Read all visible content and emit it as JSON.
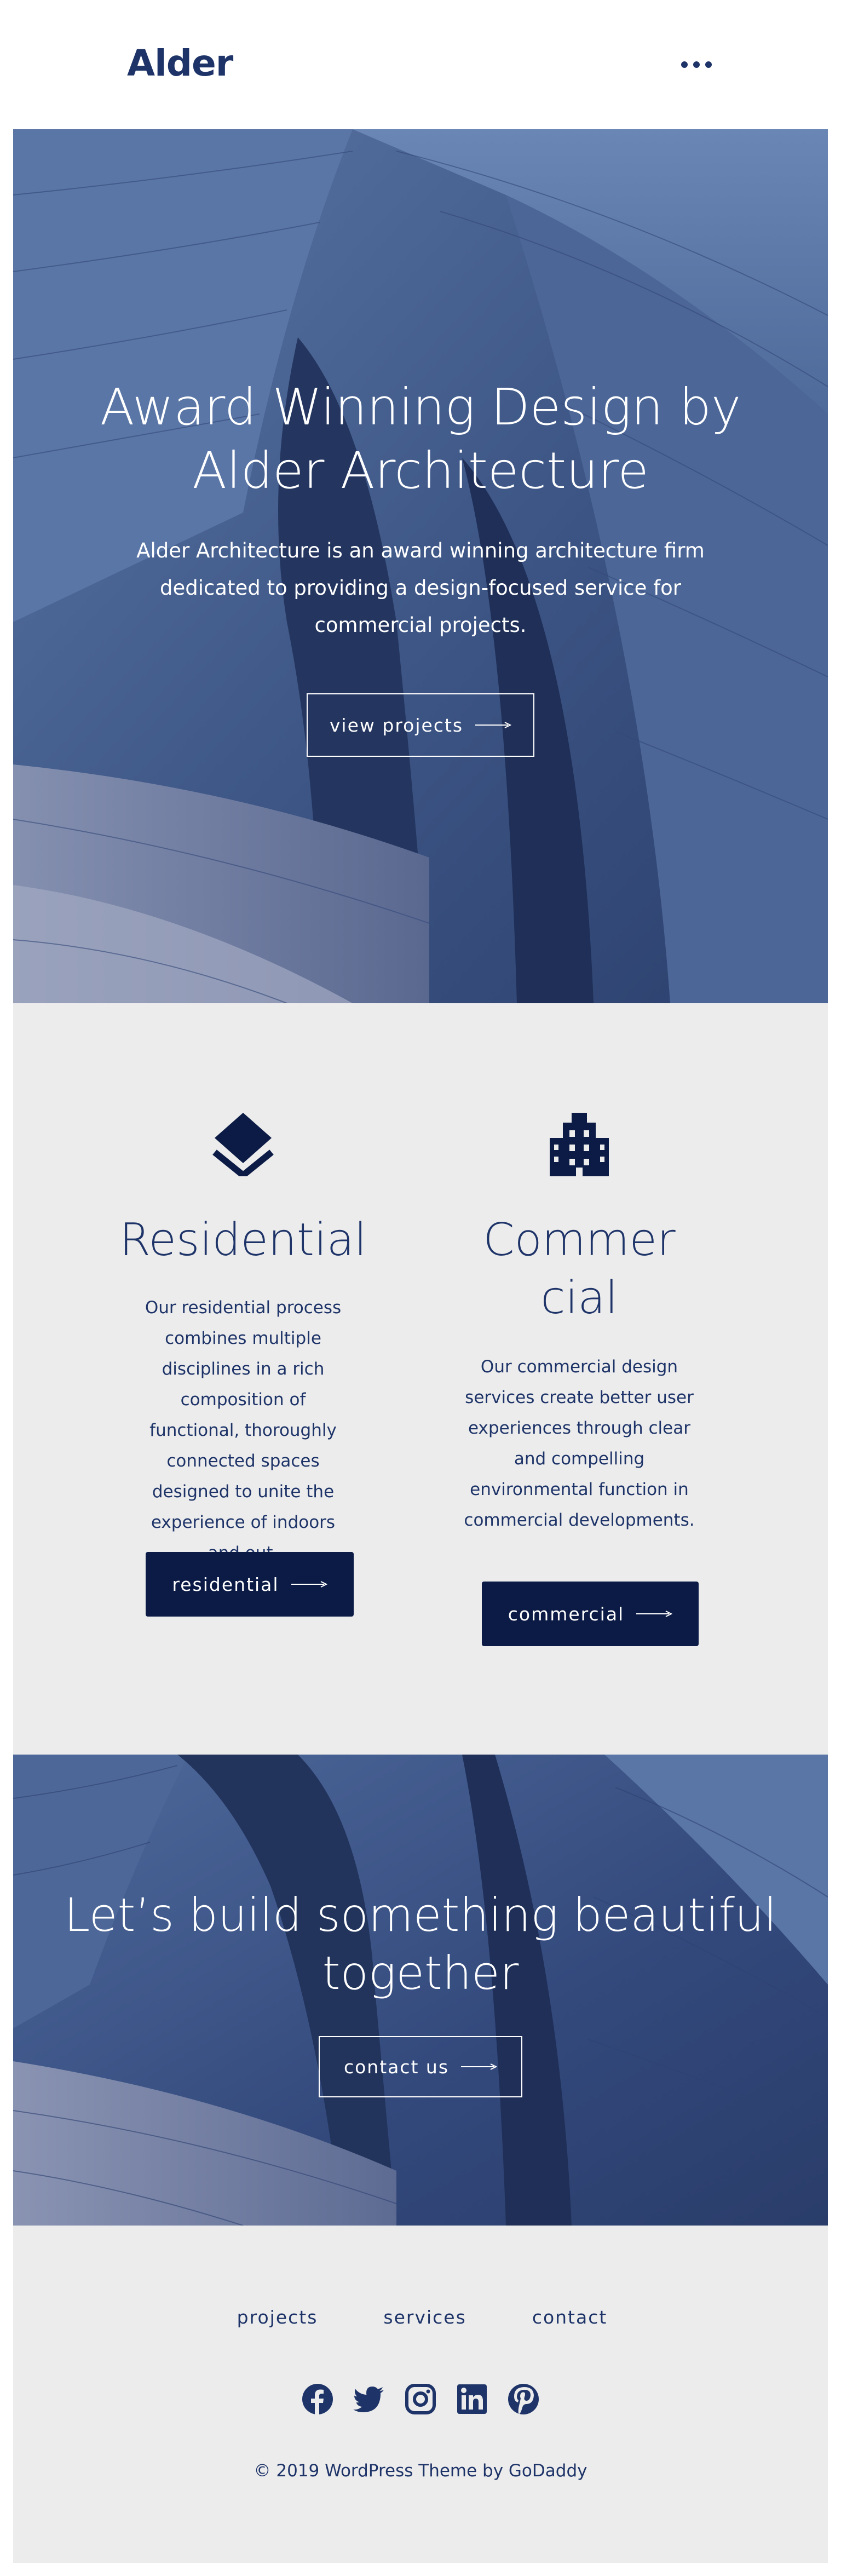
{
  "header": {
    "logo": "Alder",
    "menu_icon": "more-horizontal-icon"
  },
  "hero": {
    "title_line1": "Award Winning Design by",
    "title_line2": "Alder Architecture",
    "description": "Alder Architecture is an award winning architecture firm dedicated to providing a design-focused service for commercial projects.",
    "button_label": "view projects"
  },
  "services": {
    "residential": {
      "icon": "layers-icon",
      "title": "Residential",
      "description": "Our residential process combines multiple disciplines in a rich composition of functional, thoroughly connected spaces designed to unite the experience of indoors and out.",
      "button_label": "residential"
    },
    "commercial": {
      "icon": "building-icon",
      "title": "Commercial",
      "description": "Our commercial design services create better user experiences through clear and compelling environmental function in commercial developments.",
      "button_label": "commercial"
    }
  },
  "cta": {
    "title_line1": "Let’s build something beautiful",
    "title_line2": "together",
    "button_label": "contact us"
  },
  "footer": {
    "nav": [
      "projects",
      "services",
      "contact"
    ],
    "socials": [
      "facebook-icon",
      "twitter-icon",
      "instagram-icon",
      "linkedin-icon",
      "pinterest-icon"
    ],
    "copyright": "© 2019  WordPress Theme by GoDaddy"
  },
  "colors": {
    "brand_navy": "#1e3468",
    "button_dark": "#0b1b45",
    "section_gray": "#ececed",
    "hero_blue": "#4a6494"
  }
}
